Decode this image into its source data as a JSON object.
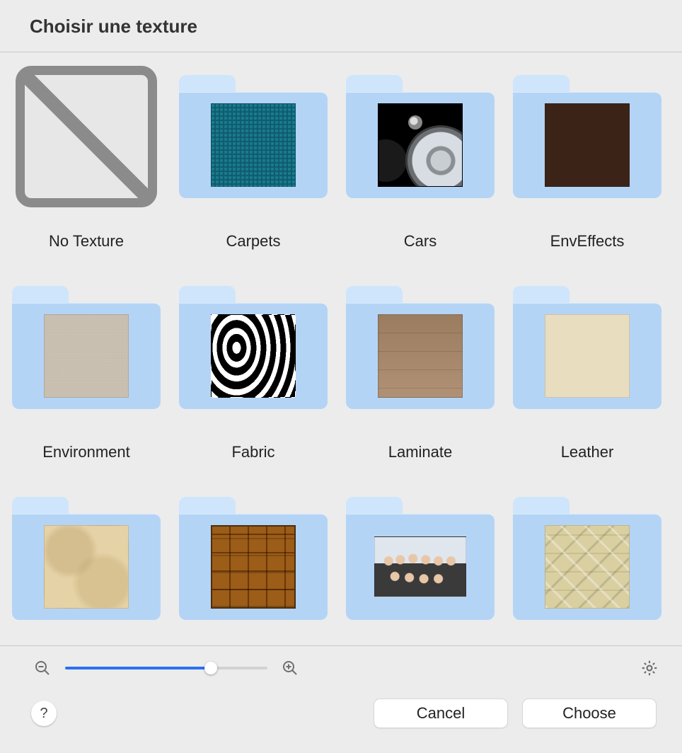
{
  "window": {
    "title": "Choisir une texture"
  },
  "grid": {
    "items": [
      {
        "id": "no-texture",
        "label": "No Texture",
        "kind": "none"
      },
      {
        "id": "carpets",
        "label": "Carpets",
        "kind": "folder",
        "swatch": "sw-carpet"
      },
      {
        "id": "cars",
        "label": "Cars",
        "kind": "folder",
        "swatch": "sw-car"
      },
      {
        "id": "enveffects",
        "label": "EnvEffects",
        "kind": "folder",
        "swatch": "sw-env"
      },
      {
        "id": "environment",
        "label": "Environment",
        "kind": "folder",
        "swatch": "sw-sand"
      },
      {
        "id": "fabric",
        "label": "Fabric",
        "kind": "folder",
        "swatch": "sw-zebra"
      },
      {
        "id": "laminate",
        "label": "Laminate",
        "kind": "folder",
        "swatch": "sw-wood"
      },
      {
        "id": "leather",
        "label": "Leather",
        "kind": "folder",
        "swatch": "sw-leather"
      },
      {
        "id": "marble",
        "label": "",
        "kind": "folder",
        "swatch": "sw-marble"
      },
      {
        "id": "parquet",
        "label": "",
        "kind": "folder",
        "swatch": "sw-parquet"
      },
      {
        "id": "people",
        "label": "",
        "kind": "folder",
        "swatch": "sw-people"
      },
      {
        "id": "stone",
        "label": "",
        "kind": "folder",
        "swatch": "sw-stone"
      }
    ]
  },
  "slider": {
    "value": 72,
    "min": 0,
    "max": 100
  },
  "buttons": {
    "help": "?",
    "cancel": "Cancel",
    "choose": "Choose"
  }
}
